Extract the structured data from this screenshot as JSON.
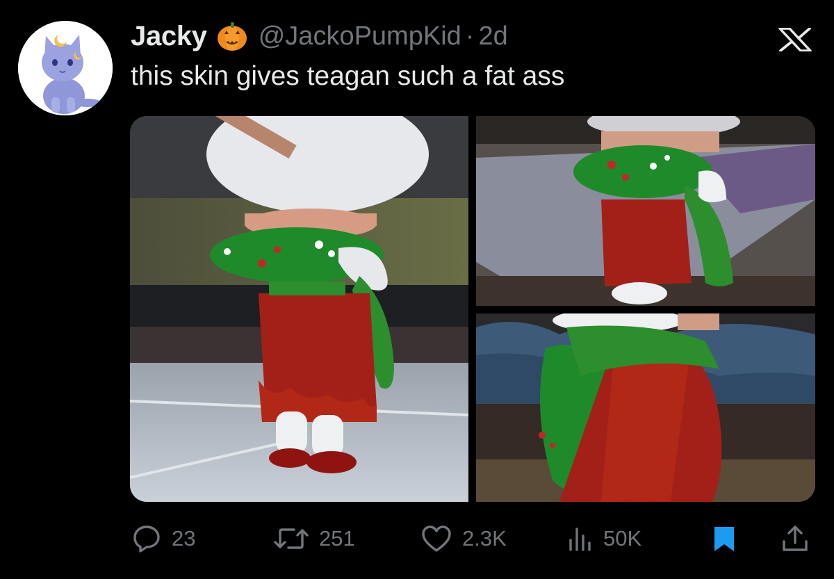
{
  "tweet": {
    "display_name": "Jacky",
    "name_emoji": "pumpkin-emoji",
    "handle": "@JackoPumpKid",
    "separator": "·",
    "age": "2d",
    "text": "this skin gives teagan such a fat ass",
    "avatar_icon": "kitten-avatar",
    "platform_icon": "x-logo-icon"
  },
  "media": {
    "image_count": 3
  },
  "actions": {
    "replies": "23",
    "reposts": "251",
    "likes": "2.3K",
    "views": "50K"
  },
  "colors": {
    "background": "#000000",
    "text_primary": "#e7e9ea",
    "text_secondary": "#71767b",
    "bookmark_active": "#1d9bf0"
  }
}
